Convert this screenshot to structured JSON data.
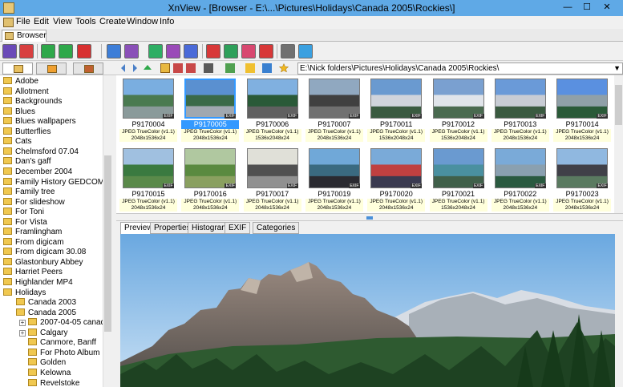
{
  "window": {
    "title": "XnView - [Browser - E:\\...\\Pictures\\Holidays\\Canada 2005\\Rockies\\]"
  },
  "window_controls": {
    "minimize": "—",
    "maximize": "☐",
    "close": "✕"
  },
  "menu": [
    "File",
    "Edit",
    "View",
    "Tools",
    "Create",
    "Window",
    "Info"
  ],
  "tab": {
    "label": "Browser"
  },
  "path": "E:\\Nick folders\\Pictures\\Holidays\\Canada 2005\\Rockies\\",
  "folders": [
    {
      "label": "Adobe",
      "level": 0
    },
    {
      "label": "Allotment",
      "level": 0
    },
    {
      "label": "Backgrounds",
      "level": 0
    },
    {
      "label": "Blues",
      "level": 0
    },
    {
      "label": "Blues wallpapers",
      "level": 0
    },
    {
      "label": "Butterflies",
      "level": 0
    },
    {
      "label": "Cats",
      "level": 0
    },
    {
      "label": "Chelmsford 07.04",
      "level": 0
    },
    {
      "label": "Dan's gaff",
      "level": 0
    },
    {
      "label": "December 2004",
      "level": 0
    },
    {
      "label": "Family History GEDCOM",
      "level": 0
    },
    {
      "label": "Family tree",
      "level": 0
    },
    {
      "label": "For slideshow",
      "level": 0
    },
    {
      "label": "For Toni",
      "level": 0
    },
    {
      "label": "For Vista",
      "level": 0
    },
    {
      "label": "Framlingham",
      "level": 0
    },
    {
      "label": "From digicam",
      "level": 0
    },
    {
      "label": "From digicam 30.08",
      "level": 0
    },
    {
      "label": "Glastonbury Abbey",
      "level": 0
    },
    {
      "label": "Harriet Peers",
      "level": 0
    },
    {
      "label": "Highlander MP4",
      "level": 0
    },
    {
      "label": "Holidays",
      "level": 0
    },
    {
      "label": "Canada 2003",
      "level": 1
    },
    {
      "label": "Canada 2005",
      "level": 1
    },
    {
      "label": "2007-04-05 canada 20",
      "level": 2,
      "expander": "+"
    },
    {
      "label": "Calgary",
      "level": 2,
      "expander": "+"
    },
    {
      "label": "Canmore, Banff",
      "level": 2
    },
    {
      "label": "For Photo Album",
      "level": 2
    },
    {
      "label": "Golden",
      "level": 2
    },
    {
      "label": "Kelowna",
      "level": 2
    },
    {
      "label": "Revelstoke",
      "level": 2
    }
  ],
  "thumbnails": [
    {
      "name": "P9170004",
      "type": "JPEG TrueColor (v1.1)",
      "size": "2048x1536x24",
      "selected": false
    },
    {
      "name": "P9170005",
      "type": "JPEG TrueColor (v1.1)",
      "size": "2048x1536x24",
      "selected": true
    },
    {
      "name": "P9170006",
      "type": "JPEG TrueColor (v1.1)",
      "size": "1536x2048x24",
      "selected": false
    },
    {
      "name": "P9170007",
      "type": "JPEG TrueColor (v1.1)",
      "size": "2048x1536x24",
      "selected": false
    },
    {
      "name": "P9170011",
      "type": "JPEG TrueColor (v1.1)",
      "size": "1536x2048x24",
      "selected": false
    },
    {
      "name": "P9170012",
      "type": "JPEG TrueColor (v1.1)",
      "size": "1536x2048x24",
      "selected": false
    },
    {
      "name": "P9170013",
      "type": "JPEG TrueColor (v1.1)",
      "size": "2048x1536x24",
      "selected": false
    },
    {
      "name": "P9170014",
      "type": "JPEG TrueColor (v1.1)",
      "size": "2048x1536x24",
      "selected": false
    },
    {
      "name": "P9170015",
      "type": "JPEG TrueColor (v1.1)",
      "size": "2048x1536x24",
      "selected": false
    },
    {
      "name": "P9170016",
      "type": "JPEG TrueColor (v1.1)",
      "size": "2048x1536x24",
      "selected": false
    },
    {
      "name": "P9170017",
      "type": "JPEG TrueColor (v1.1)",
      "size": "2048x1536x24",
      "selected": false
    },
    {
      "name": "P9170019",
      "type": "JPEG TrueColor (v1.1)",
      "size": "2048x1536x24",
      "selected": false
    },
    {
      "name": "P9170020",
      "type": "JPEG TrueColor (v1.1)",
      "size": "2048x1536x24",
      "selected": false
    },
    {
      "name": "P9170021",
      "type": "JPEG TrueColor (v1.1)",
      "size": "1536x2048x24",
      "selected": false
    },
    {
      "name": "P9170022",
      "type": "JPEG TrueColor (v1.1)",
      "size": "2048x1536x24",
      "selected": false
    },
    {
      "name": "P9170023",
      "type": "JPEG TrueColor (v1.1)",
      "size": "2048x1536x24",
      "selected": false
    }
  ],
  "exif_badge": "EXIF",
  "panel_tabs": [
    "Preview",
    "Properties",
    "Histogram",
    "EXIF",
    "Categories"
  ],
  "colors": {
    "titlebar": "#5fa9e6",
    "selection": "#3399ff",
    "thumb_label_bg": "#ffffdc",
    "sky": "#8ec1ec"
  }
}
